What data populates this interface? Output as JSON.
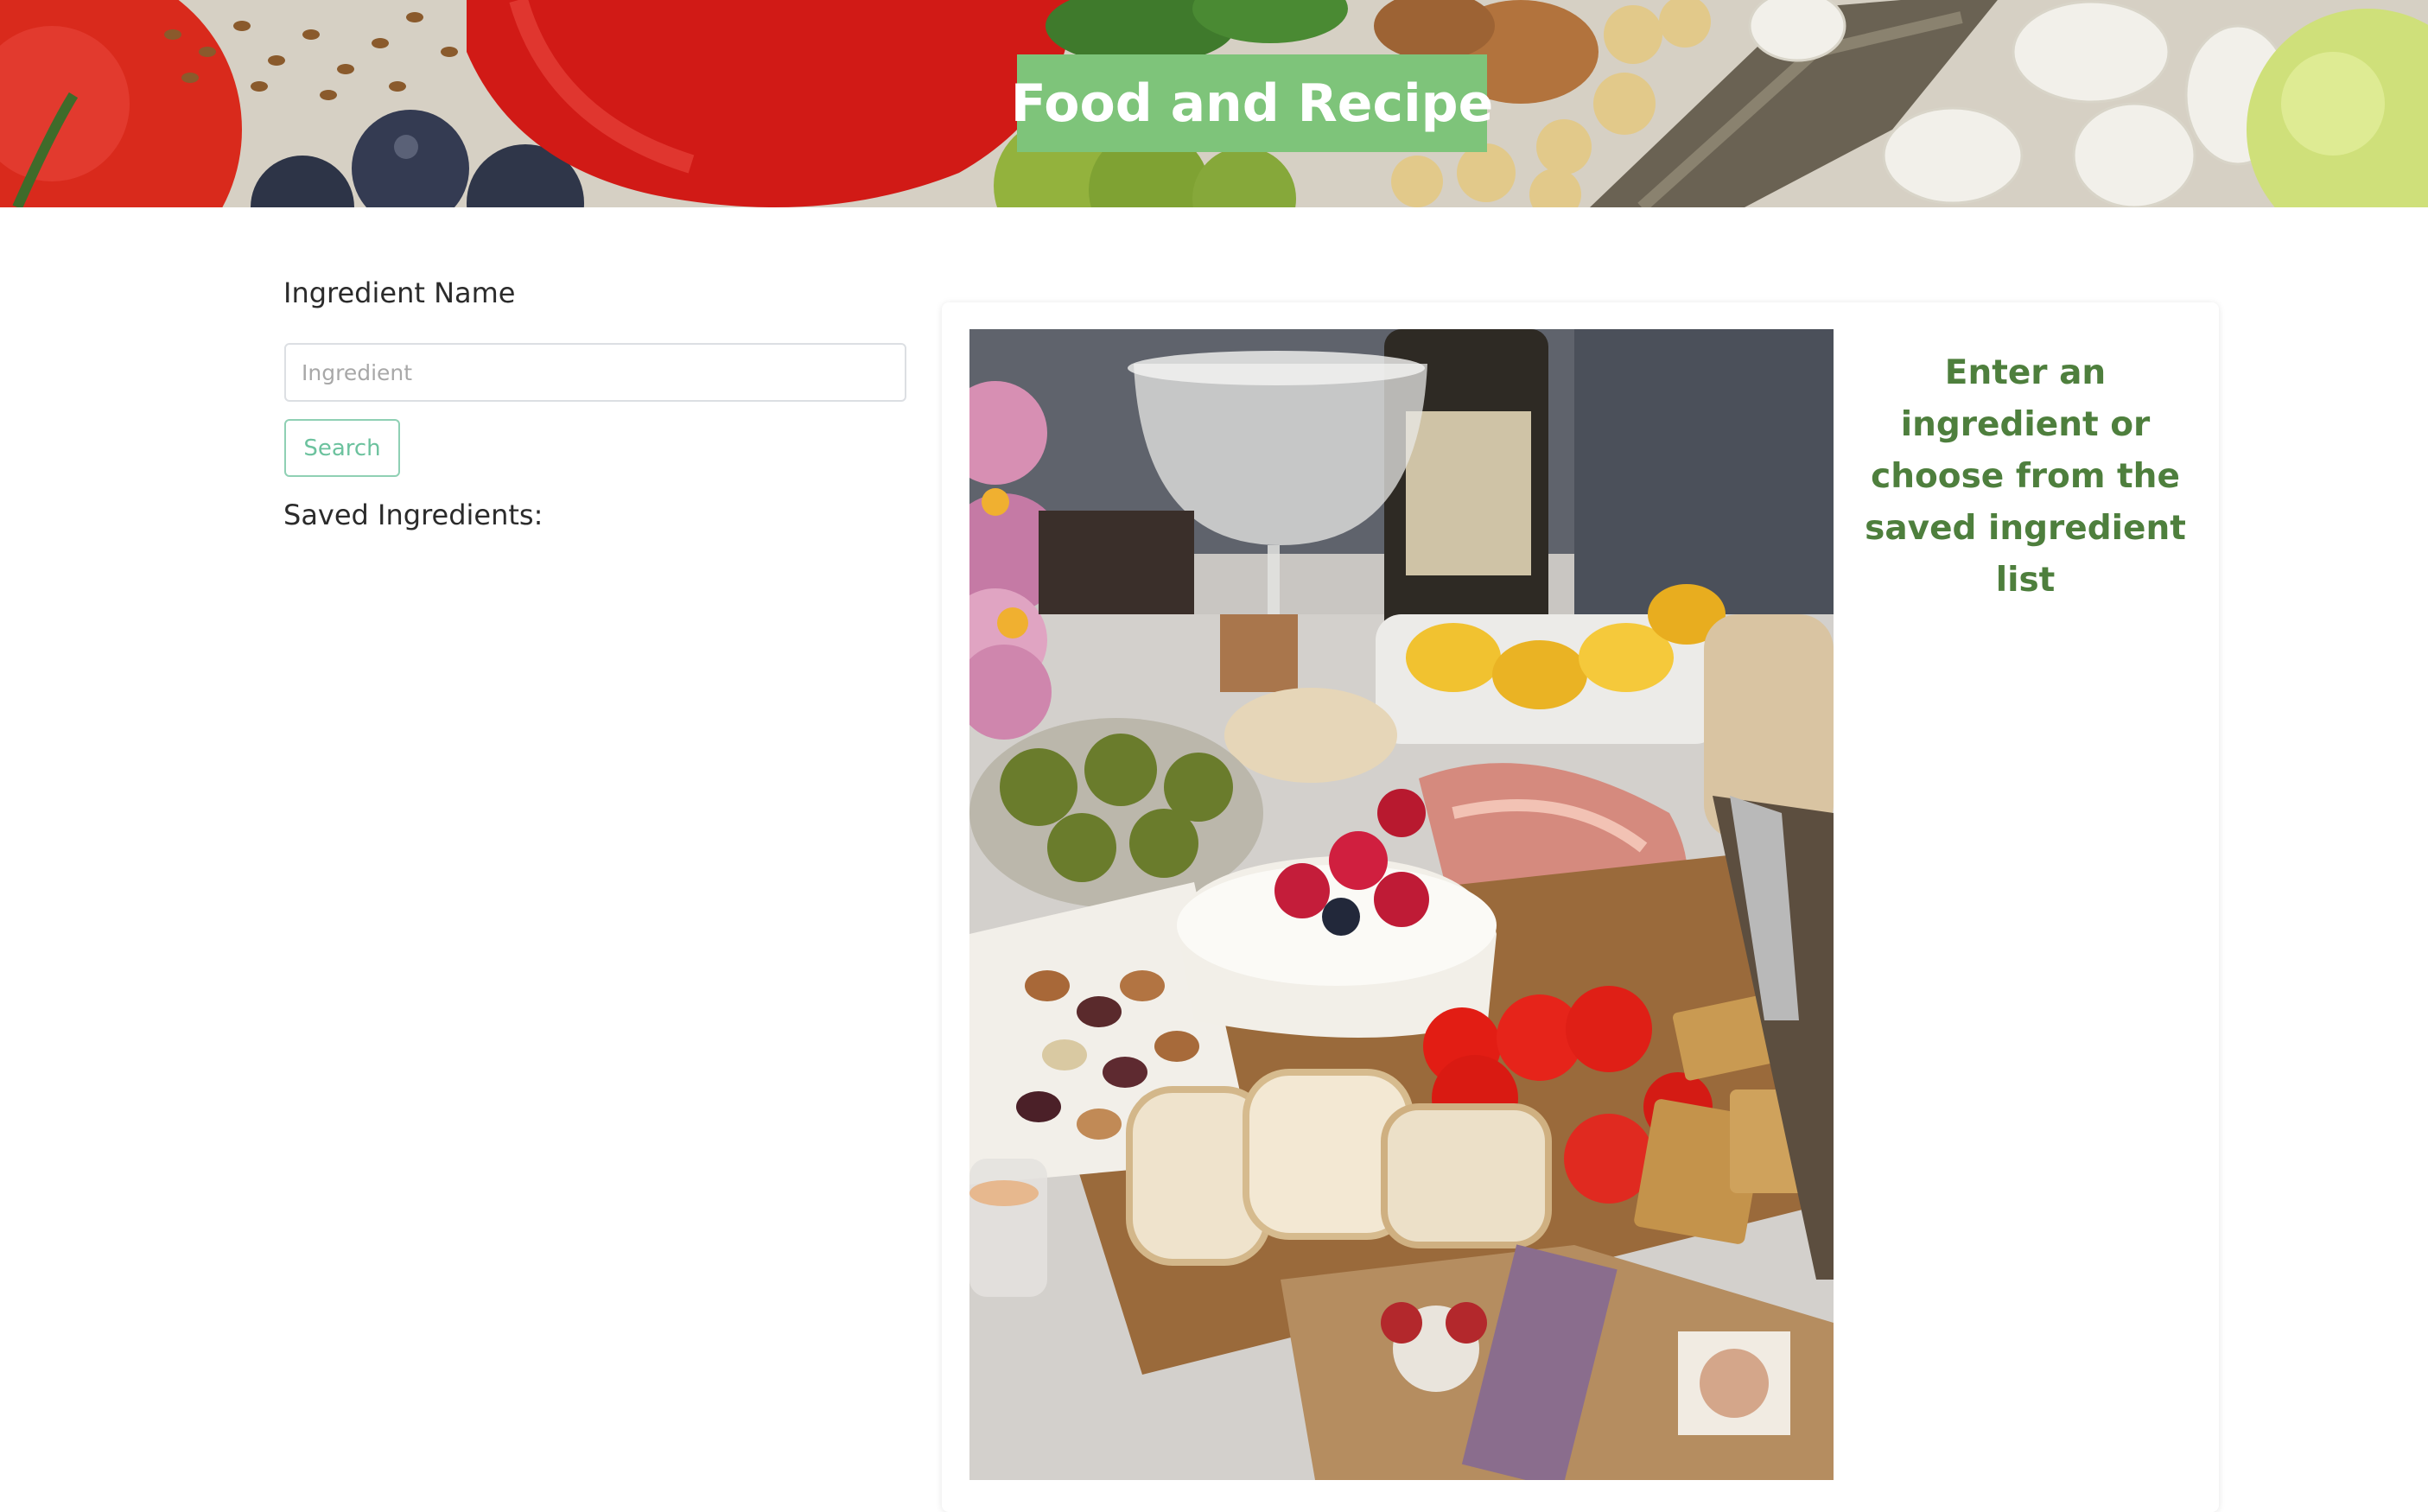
{
  "header": {
    "title": "Food and Recipe",
    "banner_image": "fresh-produce-banner"
  },
  "form": {
    "ingredient_label": "Ingredient Name",
    "ingredient_placeholder": "Ingredient",
    "ingredient_value": "",
    "search_label": "Search",
    "saved_label": "Saved Ingredients:",
    "saved_items": []
  },
  "card": {
    "image": "charcuterie-board-photo",
    "hint": "Enter an ingredient or choose from the saved ingredient list"
  },
  "colors": {
    "title_bg": "#7ec47a",
    "hint_text": "#4e7f3d",
    "button_border": "#8fd0b4",
    "button_text": "#6cc29e"
  }
}
